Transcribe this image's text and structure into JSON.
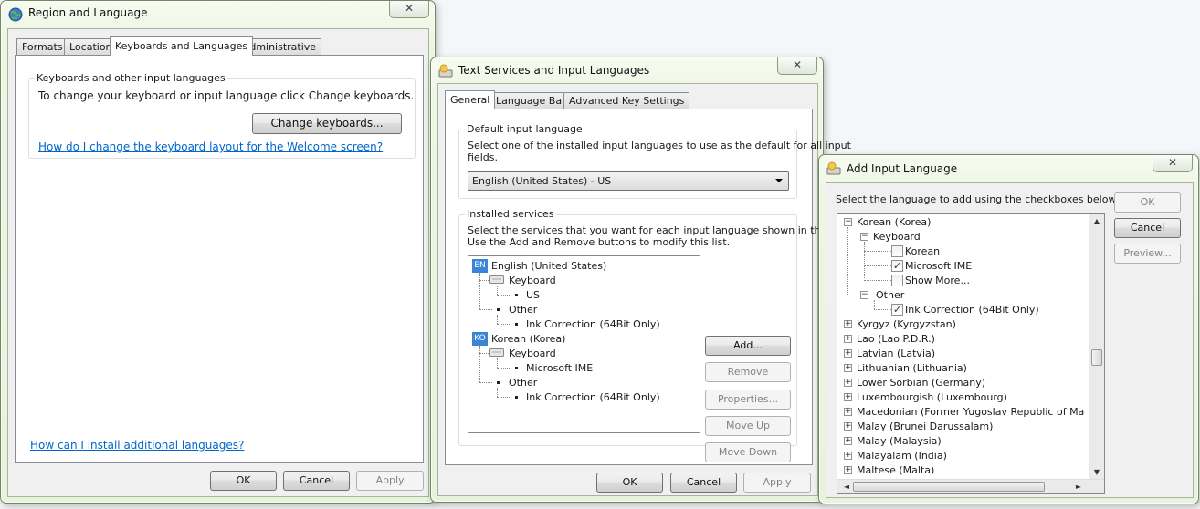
{
  "region_window": {
    "title": "Region and Language",
    "close_glyph": "✕",
    "tabs": [
      "Formats",
      "Location",
      "Keyboards and Languages",
      "Administrative"
    ],
    "group_label": "Keyboards and other input languages",
    "instruction": "To change your keyboard or input language click Change keyboards.",
    "change_keyboards_button": "Change keyboards...",
    "welcome_link": "How do I change the keyboard layout for the Welcome screen?",
    "install_link": "How can I install additional languages?",
    "ok": "OK",
    "cancel": "Cancel",
    "apply": "Apply"
  },
  "text_services_window": {
    "title": "Text Services and Input Languages",
    "close_glyph": "✕",
    "tabs": [
      "General",
      "Language Bar",
      "Advanced Key Settings"
    ],
    "default_group_label": "Default input language",
    "default_instruction": "Select one of the installed input languages to use as the default for all input fields.",
    "default_instruction_line1": "Select one of the installed input languages to use as the default for all input",
    "default_instruction_line2": "fields.",
    "default_select_value": "English (United States) - US",
    "installed_group_label": "Installed services",
    "installed_instruction_line1": "Select the services that you want for each input language shown in the list.",
    "installed_instruction_line2": "Use the Add and Remove buttons to modify this list.",
    "tree": {
      "en_badge": "EN",
      "en_label": "English (United States)",
      "en_keyboard": "Keyboard",
      "en_keyboard_item": "US",
      "en_other": "Other",
      "en_other_item": "Ink Correction (64Bit Only)",
      "ko_badge": "KO",
      "ko_label": "Korean (Korea)",
      "ko_keyboard": "Keyboard",
      "ko_keyboard_item": "Microsoft IME",
      "ko_other": "Other",
      "ko_other_item": "Ink Correction (64Bit Only)"
    },
    "add": "Add...",
    "remove": "Remove",
    "properties": "Properties...",
    "move_up": "Move Up",
    "move_down": "Move Down",
    "ok": "OK",
    "cancel": "Cancel",
    "apply": "Apply"
  },
  "add_input_window": {
    "title": "Add Input Language",
    "close_glyph": "✕",
    "instruction": "Select the language to add using the checkboxes below.",
    "ok": "OK",
    "cancel": "Cancel",
    "preview": "Preview...",
    "tree": {
      "korean": "Korean (Korea)",
      "keyboard": "Keyboard",
      "kb_korean": "Korean",
      "kb_ime": "Microsoft IME",
      "kb_more": "Show More...",
      "other": "Other",
      "ink": "Ink Correction (64Bit Only)",
      "langs": [
        "Kyrgyz (Kyrgyzstan)",
        "Lao (Lao P.D.R.)",
        "Latvian (Latvia)",
        "Lithuanian (Lithuania)",
        "Lower Sorbian (Germany)",
        "Luxembourgish (Luxembourg)",
        "Macedonian (Former Yugoslav Republic of Macedon",
        "Malay (Brunei Darussalam)",
        "Malay (Malaysia)",
        "Malayalam (India)",
        "Maltese (Malta)"
      ]
    },
    "checked": {
      "kb_korean": false,
      "kb_ime": true,
      "kb_more": false,
      "ink": true
    },
    "scroll_up": "▲",
    "scroll_down": "▼",
    "scroll_left": "◄",
    "scroll_right": "►",
    "expand_glyph": "+",
    "collapse_glyph": "−"
  }
}
